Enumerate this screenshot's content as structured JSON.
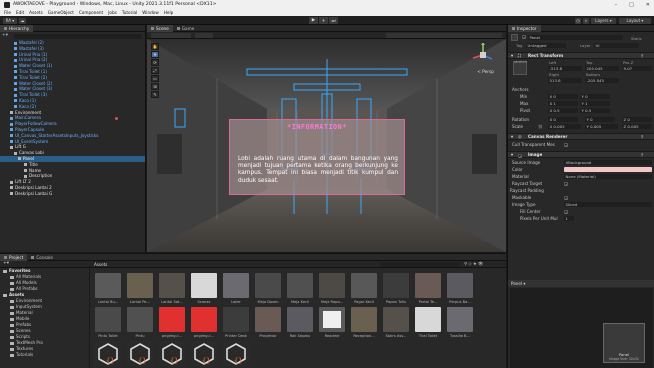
{
  "window": {
    "title": "AWOKTAEOVE - Playground - Windows, Mac, Linux - Unity 2021.3.11f1 Personal <DX11>",
    "minimize": "–",
    "maximize": "□",
    "close": "✕"
  },
  "menu": [
    "File",
    "Edit",
    "Assets",
    "GameObject",
    "Component",
    "Jobs",
    "Tutorial",
    "Window",
    "Help"
  ],
  "toolbar": {
    "account": "RA ▾",
    "cloud": "☁",
    "play": "▶",
    "pause": "⏸",
    "step": "⏭",
    "layers": "Layers",
    "layout": "Layout"
  },
  "hierarchy": {
    "tab": "Hierarchy",
    "items": [
      {
        "label": "Wastafel (2)",
        "style": "blue",
        "indent": 14
      },
      {
        "label": "Wastafel (3)",
        "style": "blue",
        "indent": 14
      },
      {
        "label": "Urinal Pria (1)",
        "style": "blue",
        "indent": 14
      },
      {
        "label": "Urinal Pria (2)",
        "style": "blue",
        "indent": 14
      },
      {
        "label": "Water Closet (1)",
        "style": "blue",
        "indent": 14
      },
      {
        "label": "Tirai Toilet (1)",
        "style": "blue",
        "indent": 14
      },
      {
        "label": "Tirai Toilet (2)",
        "style": "blue",
        "indent": 14
      },
      {
        "label": "Water Closet (2)",
        "style": "blue",
        "indent": 14
      },
      {
        "label": "Water Closet (3)",
        "style": "blue",
        "indent": 14
      },
      {
        "label": "Tirai Toilet (3)",
        "style": "blue",
        "indent": 14
      },
      {
        "label": "Kaca (1)",
        "style": "blue",
        "indent": 14
      },
      {
        "label": "Kaca (2)",
        "style": "blue",
        "indent": 14
      },
      {
        "label": "Environment",
        "style": "white",
        "indent": 10
      },
      {
        "label": "MainCamera",
        "style": "blue",
        "indent": 10,
        "dot": true
      },
      {
        "label": "PlayerFollowCamera",
        "style": "blue",
        "indent": 10
      },
      {
        "label": "PlayerCapsule",
        "style": "blue",
        "indent": 10
      },
      {
        "label": "UI_Canvas_StarterAssetsInputs_Joysticks",
        "style": "blue",
        "indent": 10
      },
      {
        "label": "UI_EventSystem",
        "style": "blue",
        "indent": 10
      },
      {
        "label": "Lift G",
        "style": "white",
        "indent": 10
      },
      {
        "label": "Canvas Lobi",
        "style": "white",
        "indent": 14
      },
      {
        "label": "Panel",
        "style": "selected",
        "indent": 18
      },
      {
        "label": "Title",
        "style": "white",
        "indent": 24
      },
      {
        "label": "Name",
        "style": "white",
        "indent": 24
      },
      {
        "label": "Description",
        "style": "white",
        "indent": 24
      },
      {
        "label": "Lift LT 2",
        "style": "white",
        "indent": 10
      },
      {
        "label": "Deskripsi Lantai 2",
        "style": "white",
        "indent": 10
      },
      {
        "label": "Deskripsi Lantai G",
        "style": "white",
        "indent": 10
      }
    ]
  },
  "scene": {
    "tabs": [
      "Scene",
      "Game"
    ],
    "persp": "< Persp",
    "tools": [
      "✋",
      "✥",
      "⟳",
      "⤢",
      "▭",
      "⊞",
      "✎"
    ],
    "info_title": "*INFORMATION*",
    "info_body": "Lobi adalah ruang utama di dalam bangunan yang menjadi tujuan pertama ketika orang berkunjung ke kampus. Tempat ini biasa menjadi titik kumpul dan duduk sesaat."
  },
  "inspector": {
    "tab": "Inspector",
    "object_name": "Panel",
    "static": "Static",
    "tag_label": "Tag",
    "tag_value": "Untagged",
    "layer_label": "Layer",
    "layer_value": "UI",
    "rect_transform": "Rect Transform",
    "stretch": "stretch",
    "left_label": "Left",
    "left_value": "-513.8",
    "top_label": "Top",
    "top_value": "205.045",
    "posz_label": "Pos Z",
    "posz_value": "9.07",
    "right_label": "Right",
    "right_value": "513.8",
    "bottom_label": "Bottom",
    "bottom_value": "-205.045",
    "anchors": "Anchors",
    "min_label": "Min",
    "min_x": "X 0",
    "min_y": "Y 0",
    "max_label": "Max",
    "max_x": "X 1",
    "max_y": "Y 1",
    "pivot_label": "Pivot",
    "pivot_x": "X 0.5",
    "pivot_y": "Y 0.5",
    "rotation_label": "Rotation",
    "rot_x": "X 0",
    "rot_y": "Y 0",
    "rot_z": "Z 0",
    "scale_label": "Scale",
    "scale_x": "X 0.005",
    "scale_y": "Y 0.005",
    "scale_z": "Z 0.005",
    "canvas_renderer": "Canvas Renderer",
    "cull_label": "Cull Transparent Mes",
    "image": "Image",
    "source_label": "Source Image",
    "source_value": "XBackground",
    "color_label": "Color",
    "material_label": "Material",
    "material_value": "None (Material)",
    "raycast_label": "Raycast Target",
    "raycast_padding": "Raycast Padding",
    "maskable_label": "Maskable",
    "image_type_label": "Image Type",
    "image_type_value": "Sliced",
    "fill_center_label": "Fill Center",
    "ppu_label": "Pixels Per Unit Mul",
    "ppu_value": "1",
    "preview_label": "Panel ▾",
    "preview_caption": "Panel",
    "preview_size": "Image Size: 32x32",
    "colors": {
      "color_swatch": "#f4c6c6"
    }
  },
  "project": {
    "tabs": [
      "Project",
      "Console"
    ],
    "favorites": "Favorites",
    "fav_items": [
      "All Materials",
      "All Models",
      "All Prefabs"
    ],
    "assets_root": "Assets",
    "folders": [
      "Environment",
      "InputSystem",
      "Material",
      "Mobile",
      "Prefabs",
      "Scenes",
      "Scripts",
      "TextMesh Pro",
      "Textures",
      "Tutorials"
    ],
    "breadcrumb": "Assets",
    "row1": [
      "Lantai Bu...",
      "Lantai Pe...",
      "Lantai Sat...",
      "Scanax",
      "Loker",
      "Meja Dosen",
      "Meja Kecil",
      "Meja Rapa...",
      "Pagar Kecil",
      "Papan Tulis",
      "Partai Te...",
      "Perpus Ba..."
    ],
    "row2": [
      "Pintu Toilet",
      "Pintu",
      "pngimg.c...",
      "pngimg.c...",
      "Printer Desk",
      "Proyektor",
      "Rak Sepatu",
      "Readme",
      "Reception...",
      "Stairs Ass...",
      "Tirai Toilet",
      "Tussilla B..."
    ]
  }
}
